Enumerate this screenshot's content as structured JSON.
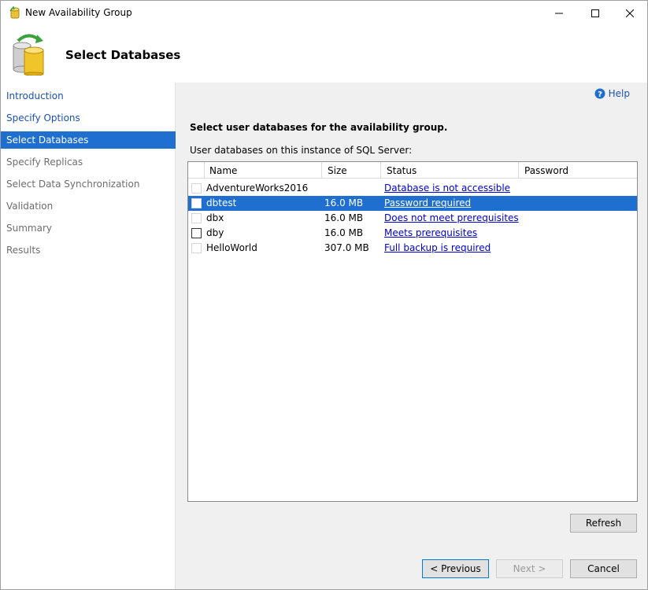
{
  "window": {
    "title": "New Availability Group"
  },
  "banner": {
    "title": "Select Databases"
  },
  "nav": {
    "items": [
      {
        "label": "Introduction",
        "state": "link"
      },
      {
        "label": "Specify Options",
        "state": "link"
      },
      {
        "label": "Select Databases",
        "state": "active"
      },
      {
        "label": "Specify Replicas",
        "state": "disabled"
      },
      {
        "label": "Select Data Synchronization",
        "state": "disabled"
      },
      {
        "label": "Validation",
        "state": "disabled"
      },
      {
        "label": "Summary",
        "state": "disabled"
      },
      {
        "label": "Results",
        "state": "disabled"
      }
    ]
  },
  "content": {
    "help_label": "Help",
    "section_title": "Select user databases for the availability group.",
    "list_caption": "User databases on this instance of SQL Server:",
    "columns": {
      "name": "Name",
      "size": "Size",
      "status": "Status",
      "password": "Password"
    },
    "rows": [
      {
        "name": "AdventureWorks2016",
        "size": "",
        "status": "Database is not accessible",
        "selected": false,
        "enabled": false
      },
      {
        "name": "dbtest",
        "size": "16.0 MB",
        "status": "Password required",
        "selected": true,
        "enabled": false
      },
      {
        "name": "dbx",
        "size": "16.0 MB",
        "status": "Does not meet prerequisites",
        "selected": false,
        "enabled": false
      },
      {
        "name": "dby",
        "size": "16.0 MB",
        "status": "Meets prerequisites",
        "selected": false,
        "enabled": true
      },
      {
        "name": "HelloWorld",
        "size": "307.0 MB",
        "status": "Full backup is required",
        "selected": false,
        "enabled": false
      }
    ]
  },
  "buttons": {
    "refresh": "Refresh",
    "previous": "< Previous",
    "next": "Next >",
    "cancel": "Cancel"
  },
  "colors": {
    "selection": "#1e6fd0",
    "link": "#1a52b4"
  }
}
